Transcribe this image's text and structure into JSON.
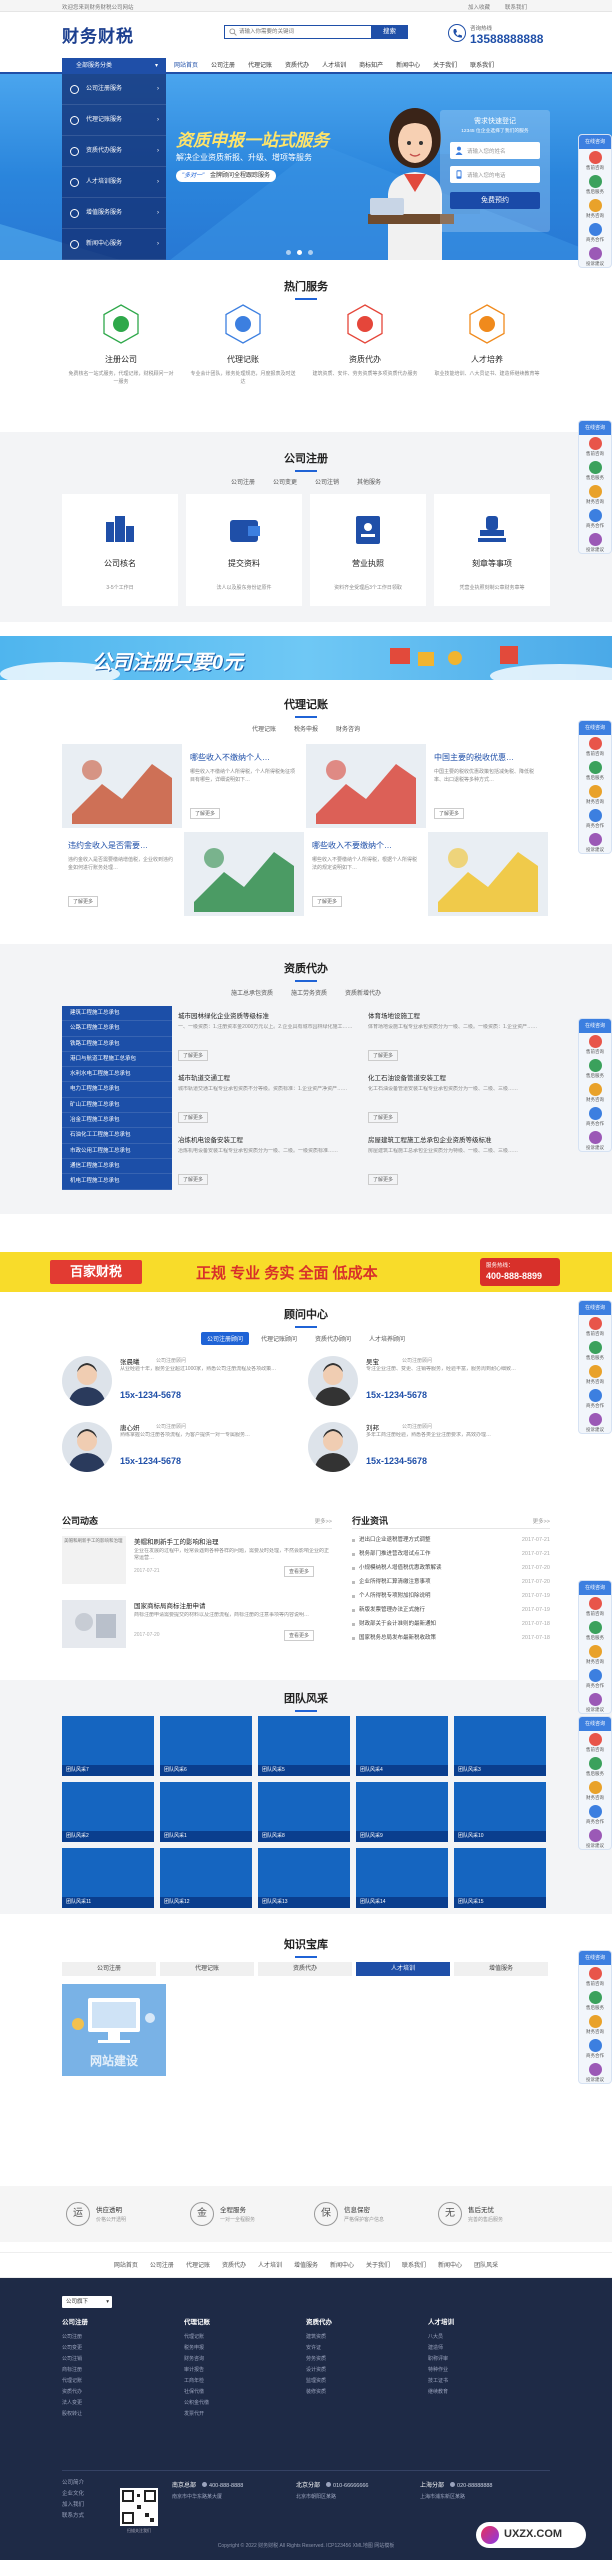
{
  "topbar": {
    "notice": "欢迎您来到财务财税公司网站",
    "links": [
      "加入收藏",
      "联系我们"
    ]
  },
  "header": {
    "logo": "财务财税",
    "search_placeholder": "请输入你需要的关键词",
    "search_button": "搜索",
    "hotline_label": "咨询热线",
    "hotline": "13588888888"
  },
  "nav": {
    "items": [
      "网站首页",
      "公司注册",
      "代理记账",
      "资质代办",
      "人才培训",
      "商标知产",
      "新闻中心",
      "关于我们",
      "联系我们"
    ],
    "category_label": "全部服务分类"
  },
  "side_menu": [
    "公司注册服务",
    "代理记账服务",
    "资质代办服务",
    "人才培训服务",
    "增值服务服务",
    "新闻中心服务"
  ],
  "banner": {
    "headline": "资质申报一站式服务",
    "sub": "解决企业资质新报、升级、增项等服务",
    "tag": "\"多对一\"",
    "tag_text": "金牌顾问全程跟踪服务",
    "form_title": "需求快速登记",
    "form_sub": "12345 位企业选择了我们的服务",
    "name_placeholder": "请输入您的姓名",
    "phone_placeholder": "请输入您的电话",
    "submit": "免费预约"
  },
  "hot": {
    "title": "热门服务",
    "items": [
      {
        "name": "注册公司",
        "desc": "免费核名一站式服务，代理记账，财税顾问一对一服务",
        "color": "#2ea84a"
      },
      {
        "name": "代理记账",
        "desc": "专业会计团队，账务处理规范，月度报表及时送达",
        "color": "#3c7fe0"
      },
      {
        "name": "资质代办",
        "desc": "建筑资质、安许、劳务资质等多项资质代办服务",
        "color": "#e5463a"
      },
      {
        "name": "人才培养",
        "desc": "职业技能培训、八大员证书、建造师继续教育等",
        "color": "#f08a1c"
      }
    ]
  },
  "reg": {
    "title": "公司注册",
    "tabs": [
      "公司注册",
      "公司变更",
      "公司注销",
      "其他服务"
    ],
    "items": [
      {
        "name": "公司核名",
        "desc": "3-5个工作日"
      },
      {
        "name": "提交资料",
        "desc": "法人以及股东身份证原件"
      },
      {
        "name": "营业执照",
        "desc": "资料齐全受理后3个工作日领取"
      },
      {
        "name": "刻章等事项",
        "desc": "凭营业执照刻制公章财务章等"
      }
    ]
  },
  "ad1": {
    "text": "公司注册只要0元"
  },
  "acc": {
    "title": "代理记账",
    "tabs": [
      "代理记账",
      "税务申报",
      "财务咨询"
    ],
    "items": [
      {
        "title": "哪些收入不缴纳个人…",
        "desc": "哪些收入不缴纳个人所得税，个人所得税免征项目有哪些，详细说明如下…",
        "btn": "了解更多"
      },
      {
        "title": "中国主要的税收优惠…",
        "desc": "中国主要的税收优惠政策包括减免税、降低税率、出口退税等多种方式…",
        "btn": "了解更多"
      },
      {
        "title": "违约金收入是否需要…",
        "desc": "违约金收入是否需要缴纳增值税，企业收到违约金如何进行账务处理…",
        "btn": "了解更多"
      },
      {
        "title": "哪些收入不要缴纳个…",
        "desc": "哪些收入不要缴纳个人所得税，根据个人所得税法的规定说明如下…",
        "btn": "了解更多"
      }
    ]
  },
  "qual": {
    "title": "资质代办",
    "tabs": [
      "施工总承包资质",
      "施工劳务资质",
      "资质新增代办"
    ],
    "menu": [
      "建筑工程施工总承包",
      "公路工程施工总承包",
      "铁路工程施工总承包",
      "港口与航道工程施工总承包",
      "水利水电工程施工总承包",
      "电力工程施工总承包",
      "矿山工程施工总承包",
      "冶金工程施工总承包",
      "石油化工工程施工总承包",
      "市政公用工程施工总承包",
      "通信工程施工总承包",
      "机电工程施工总承包"
    ],
    "items": [
      {
        "title": "城市园林绿化企业资质等级标准",
        "desc": "一、一级资质：1.注册资本金2000万元以上。2.企业具有城市园林绿化施工……",
        "btn": "了解更多"
      },
      {
        "title": "体育场地设施工程",
        "desc": "体育场地设施工程专业承包资质分为一级、二级。一级资质：1.企业资产……",
        "btn": "了解更多"
      },
      {
        "title": "城市轨道交通工程",
        "desc": "城市轨道交通工程专业承包资质不分等级。资质标准：1.企业资产净资产……",
        "btn": "了解更多"
      },
      {
        "title": "化工石油设备管道安装工程",
        "desc": "化工石油设备管道安装工程专业承包资质分为一级、二级、三级……",
        "btn": "了解更多"
      },
      {
        "title": "冶炼机电设备安装工程",
        "desc": "冶炼机电设备安装工程专业承包资质分为一级、二级。一级资质标准……",
        "btn": "了解更多"
      },
      {
        "title": "房屋建筑工程施工总承包企业资质等级标准",
        "desc": "房屋建筑工程施工总承包企业资质分为特级、一级、二级、三级……",
        "btn": "了解更多"
      }
    ]
  },
  "ad2": {
    "brand": "百家财税",
    "slogan": "正规 专业 务实 全面 低成本",
    "hotline_label": "服务热线：",
    "hotline": "400-888-8899"
  },
  "advisor": {
    "title": "顾问中心",
    "tabs": [
      "公司注册顾问",
      "代理记账顾问",
      "资质代办顾问",
      "人才培养顾问"
    ],
    "items": [
      {
        "name": "张晨曦",
        "role": "公司注册顾问",
        "desc": "从业经验十年，服务企业超过1000家，熟悉公司注册流程及各项政策…",
        "phone": "15x-1234-5678"
      },
      {
        "name": "吴宝",
        "role": "公司注册顾问",
        "desc": "专注企业注册、变更、注销等服务，经验丰富，服务周到耐心细致…",
        "phone": "15x-1234-5678"
      },
      {
        "name": "唐心妍",
        "role": "公司注册顾问",
        "desc": "熟练掌握公司注册各项流程，为客户提供一对一专属服务…",
        "phone": "15x-1234-5678"
      },
      {
        "name": "刘邦",
        "role": "公司注册顾问",
        "desc": "多年工商注册经验，熟悉各类企业注册要求，高效办理…",
        "phone": "15x-1234-5678"
      }
    ]
  },
  "news": {
    "left_title": "公司动态",
    "left_more": "更多>>",
    "left_items": [
      {
        "title": "美帽和刷新手工的影响和治理",
        "desc": "企业在发展的过程中，经常会遇到各种各样的问题，需要及时处理，不然会影响企业的正常运营…",
        "date": "2017-07-21",
        "btn": "查看更多"
      },
      {
        "title": "国家商标局商标注册申请",
        "desc": "商标注册申请需要提交的材料以及注册流程，商标注册的注意事项等内容说明…",
        "date": "2017-07-20",
        "btn": "查看更多"
      }
    ],
    "img_caption": "美帽和刷新手工的影响和治理",
    "right_title": "行业资讯",
    "right_more": "更多>>",
    "right_items": [
      {
        "title": "进出口企业退税管理方式调整",
        "date": "2017-07-21"
      },
      {
        "title": "税务部门推进营改增试点工作",
        "date": "2017-07-21"
      },
      {
        "title": "小规模纳税人增值税优惠政策解读",
        "date": "2017-07-20"
      },
      {
        "title": "企业所得税汇算清缴注意事项",
        "date": "2017-07-20"
      },
      {
        "title": "个人所得税专项附加扣除说明",
        "date": "2017-07-19"
      },
      {
        "title": "新版发票管理办法正式施行",
        "date": "2017-07-19"
      },
      {
        "title": "财政部关于会计准则的最新通知",
        "date": "2017-07-18"
      },
      {
        "title": "国家税务总局发布最新税收政策",
        "date": "2017-07-18"
      }
    ]
  },
  "team": {
    "title": "团队风采",
    "items": [
      "团队风采7",
      "团队风采6",
      "团队风采5",
      "团队风采4",
      "团队风采3",
      "团队风采2",
      "团队风采1",
      "团队风采8",
      "团队风采9",
      "团队风采10",
      "团队风采11",
      "团队风采12",
      "团队风采13",
      "团队风采14",
      "团队风采15"
    ]
  },
  "knowledge": {
    "title": "知识宝库",
    "tabs": [
      "公司注册",
      "代理记账",
      "资质代办",
      "人才培训",
      "增值服务"
    ],
    "card_text": "网站建设"
  },
  "promises": [
    {
      "title": "供应透明",
      "desc": "价格公开透明",
      "icon": "运"
    },
    {
      "title": "全程服务",
      "desc": "一对一全程服务",
      "icon": "金"
    },
    {
      "title": "信息保密",
      "desc": "严格保护客户信息",
      "icon": "保"
    },
    {
      "title": "售后无忧",
      "desc": "完善的售后服务",
      "icon": "无"
    }
  ],
  "footer_nav": [
    "网站首页",
    "公司注册",
    "代理记账",
    "资质代办",
    "人才培训",
    "增值服务",
    "新闻中心",
    "关于我们",
    "联系我们",
    "新闻中心",
    "团队风采"
  ],
  "footer": {
    "select_label": "公司旗下",
    "columns": [
      {
        "title": "公司注册",
        "links": [
          "公司注册",
          "公司变更",
          "公司注销",
          "商标注册",
          "代理记账",
          "资质代办",
          "法人变更",
          "股权转让"
        ]
      },
      {
        "title": "代理记账",
        "links": [
          "代理记账",
          "税务申报",
          "财务咨询",
          "审计报告",
          "工商年检",
          "社保代缴",
          "公积金代缴",
          "发票代开"
        ]
      },
      {
        "title": "资质代办",
        "links": [
          "建筑资质",
          "安许证",
          "劳务资质",
          "设计资质",
          "监理资质",
          "装修资质"
        ]
      },
      {
        "title": "人才培训",
        "links": [
          "八大员",
          "建造师",
          "职称评审",
          "特种作业",
          "技工证书",
          "继续教育"
        ]
      }
    ],
    "offices": [
      {
        "name": "南京总部",
        "phone": "400-888-8888",
        "addr": "南京市中华东路某大厦"
      },
      {
        "name": "北京分部",
        "phone": "010-66666666",
        "addr": "北京市朝阳区某路"
      },
      {
        "name": "上海分部",
        "phone": "020-88888888",
        "addr": "上海市浦东新区某路"
      }
    ],
    "bottom_links": [
      "公司简介",
      "企业文化",
      "加入我们",
      "联系方式"
    ],
    "copyright": "Copyright © 2022 财务财税 All Rights Reserved.   ICP123456   XML地图   网站模板",
    "watermark": "UXZX.COM",
    "qr_label": "扫描关注我们"
  },
  "float_panel": {
    "top": "在线咨询",
    "items": [
      "售前咨询",
      "售后服务",
      "财务咨询",
      "商务合作",
      "投诉建议"
    ]
  }
}
